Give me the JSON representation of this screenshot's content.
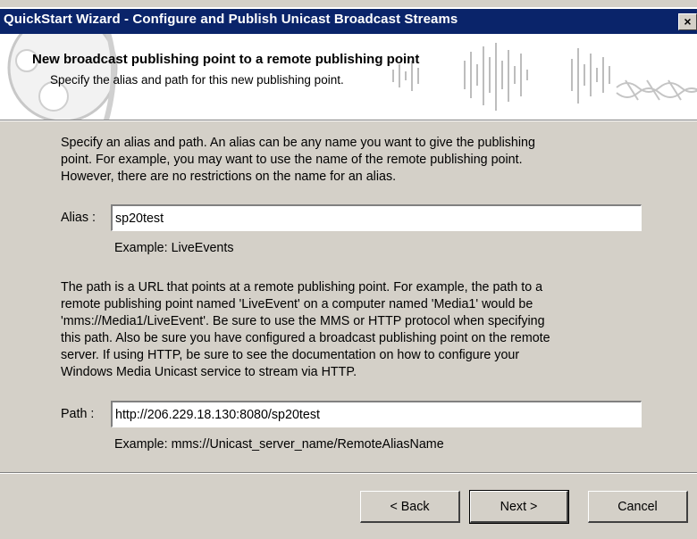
{
  "window": {
    "title": "QuickStart Wizard - Configure and Publish Unicast Broadcast Streams",
    "close_glyph": "×"
  },
  "header": {
    "title": "New broadcast publishing point to a remote publishing point",
    "subtitle": "Specify the alias and path for this new publishing point."
  },
  "main": {
    "alias_intro": "Specify an alias and path.  An alias can be any name you want to give the publishing\npoint.  For example, you may want to use the name of the remote publishing point.\nHowever, there are no restrictions on the name for an alias.",
    "alias_label": "Alias :",
    "alias_value": "sp20test",
    "alias_example": "Example: LiveEvents",
    "path_intro": "The path is a URL that points at a remote publishing point.  For example, the path to a\nremote publishing point named 'LiveEvent' on a computer named 'Media1' would be\n'mms://Media1/LiveEvent'.  Be sure to use the MMS or HTTP protocol when specifying\nthis path.  Also be sure you have configured a broadcast publishing point on the remote\nserver.  If using HTTP, be sure to see the documentation on how to configure your\nWindows Media Unicast service to stream via HTTP.",
    "path_label": "Path :",
    "path_value": "http://206.229.18.130:8080/sp20test",
    "path_example": "Example:  mms://Unicast_server_name/RemoteAliasName"
  },
  "footer": {
    "back_label": "< Back",
    "next_label": "Next >",
    "cancel_label": "Cancel"
  },
  "colors": {
    "titlebar": "#0a246a",
    "dialog": "#d4d0c8"
  }
}
